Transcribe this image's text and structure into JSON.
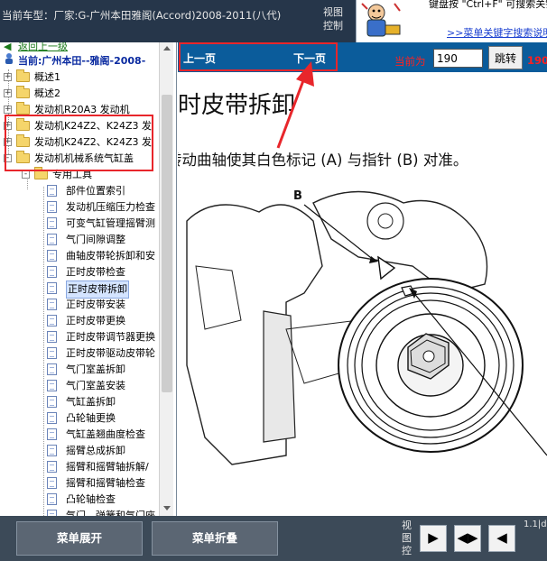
{
  "header": {
    "car_label": "当前车型：厂家:G-广州本田雅阁(Accord)2008-2011(八代)",
    "view_control": "视图控制",
    "tip_text": "键盘按 \"Ctrl+F\" 可搜索关键字！",
    "tip_link": ">>菜单关键字搜索说明"
  },
  "tree": {
    "back_link": "返回上一级",
    "current_car": "当前:广州本田--雅阁-2008-",
    "items": [
      {
        "label": "概述1",
        "level": 0,
        "type": "folder",
        "expander": "+"
      },
      {
        "label": "概述2",
        "level": 0,
        "type": "folder",
        "expander": "+"
      },
      {
        "label": "发动机R20A3 发动机",
        "level": 0,
        "type": "folder",
        "expander": "+"
      },
      {
        "label": "发动机K24Z2、K24Z3 发",
        "level": 0,
        "type": "folder",
        "expander": "+"
      },
      {
        "label": "发动机K24Z2、K24Z3 发",
        "level": 0,
        "type": "folder",
        "expander": "+"
      },
      {
        "label": "发动机机械系统气缸盖",
        "level": 0,
        "type": "folder",
        "expander": "-"
      },
      {
        "label": "专用工具",
        "level": 1,
        "type": "folder",
        "expander": "-"
      },
      {
        "label": "部件位置索引",
        "level": 2,
        "type": "doc"
      },
      {
        "label": "发动机压缩压力检查",
        "level": 2,
        "type": "doc"
      },
      {
        "label": "可变气缸管理摇臂测",
        "level": 2,
        "type": "doc"
      },
      {
        "label": "气门间隙调整",
        "level": 2,
        "type": "doc"
      },
      {
        "label": "曲轴皮带轮拆卸和安",
        "level": 2,
        "type": "doc"
      },
      {
        "label": "正时皮带检查",
        "level": 2,
        "type": "doc"
      },
      {
        "label": "正时皮带拆卸",
        "level": 2,
        "type": "doc",
        "selected": true
      },
      {
        "label": "正时皮带安装",
        "level": 2,
        "type": "doc"
      },
      {
        "label": "正时皮带更换",
        "level": 2,
        "type": "doc"
      },
      {
        "label": "正时皮带调节器更换",
        "level": 2,
        "type": "doc"
      },
      {
        "label": "正时皮带驱动皮带轮",
        "level": 2,
        "type": "doc"
      },
      {
        "label": "气门室盖拆卸",
        "level": 2,
        "type": "doc"
      },
      {
        "label": "气门室盖安装",
        "level": 2,
        "type": "doc"
      },
      {
        "label": "气缸盖拆卸",
        "level": 2,
        "type": "doc"
      },
      {
        "label": "凸轮轴更换",
        "level": 2,
        "type": "doc"
      },
      {
        "label": "气缸盖翘曲度检查",
        "level": 2,
        "type": "doc"
      },
      {
        "label": "摇臂总成拆卸",
        "level": 2,
        "type": "doc"
      },
      {
        "label": "摇臂和摇臂轴拆解/",
        "level": 2,
        "type": "doc"
      },
      {
        "label": "摇臂和摇臂轴检查",
        "level": 2,
        "type": "doc"
      },
      {
        "label": "凸轮轴检查",
        "level": 2,
        "type": "doc"
      },
      {
        "label": "气门、弹簧和气门座",
        "level": 2,
        "type": "doc"
      }
    ]
  },
  "nav": {
    "prev": "上一页",
    "next": "下一页",
    "current_label": "当前为",
    "page_value": "190",
    "jump": "跳转",
    "page_total": "190"
  },
  "content": {
    "title": "时皮带拆卸",
    "step": "转动曲轴使其白色标记 (A) 与指针 (B) 对准。",
    "figure_label_b": "B"
  },
  "bottom": {
    "expand": "菜单展开",
    "collapse": "菜单折叠",
    "view_control": "视图控",
    "btn_right": "▶",
    "btn_both": "◀▶",
    "btn_left": "◀",
    "corner": "1.1|d"
  },
  "colors": {
    "topbar": "#26364a",
    "navbar": "#0b5c9b",
    "highlight": "#e8262b",
    "bottombar": "#3c4a58"
  }
}
